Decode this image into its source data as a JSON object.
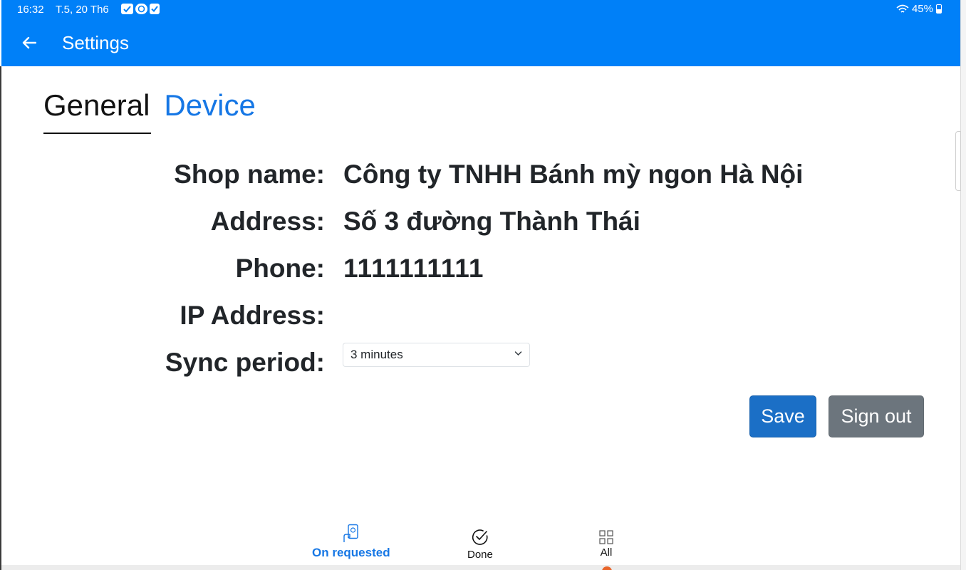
{
  "status_bar": {
    "time": "16:32",
    "date": "T.5, 20 Th6",
    "battery": "45%",
    "icons": [
      "mail-check-icon",
      "chat-app-icon",
      "checkbox-icon",
      "wifi-icon",
      "battery-icon"
    ]
  },
  "header": {
    "title": "Settings",
    "back_icon": "arrow-left-icon"
  },
  "tabs": [
    {
      "label": "General",
      "active": true
    },
    {
      "label": "Device",
      "active": false
    }
  ],
  "form": {
    "shop_name_label": "Shop name:",
    "shop_name_value": "Công ty TNHH Bánh mỳ ngon Hà Nội",
    "address_label": "Address:",
    "address_value": "Số 3 đường Thành Thái",
    "phone_label": "Phone:",
    "phone_value": "1111111111",
    "ip_label": "IP Address:",
    "ip_value": "",
    "sync_label": "Sync period:",
    "sync_selected": "3 minutes"
  },
  "actions": {
    "save_label": "Save",
    "signout_label": "Sign out"
  },
  "bottom_nav": [
    {
      "label": "On requested",
      "icon": "hand-phone-icon",
      "active": true
    },
    {
      "label": "Done",
      "icon": "check-circle-icon",
      "active": false
    },
    {
      "label": "All",
      "icon": "grid-icon",
      "active": false
    }
  ],
  "colors": {
    "primary": "#0080f8",
    "tab_inactive": "#1677e5",
    "save_button": "#1b6fc6",
    "signout_button": "#6c757d",
    "text": "#212529"
  }
}
